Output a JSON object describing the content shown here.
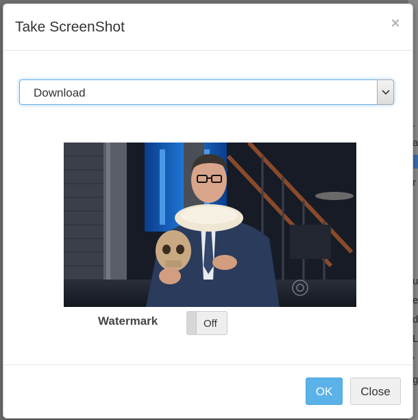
{
  "background_page": {
    "fragments": [
      ".",
      "a",
      "r",
      "u",
      "e",
      "d",
      "L",
      "'",
      "g"
    ]
  },
  "dialog": {
    "title": "Take ScreenShot",
    "close_glyph": "×",
    "format_select": {
      "value": "Download",
      "arrow_icon": "chevron-down-icon"
    },
    "preview": {
      "description_icon": "video-frame-thumbnail"
    },
    "watermark": {
      "label": "Watermark",
      "toggle_state": "Off"
    },
    "buttons": {
      "ok": "OK",
      "close": "Close"
    }
  },
  "colors": {
    "accent": "#5bb2e8",
    "focus_border": "#66afe9",
    "overlay": "#6f6f6f"
  }
}
